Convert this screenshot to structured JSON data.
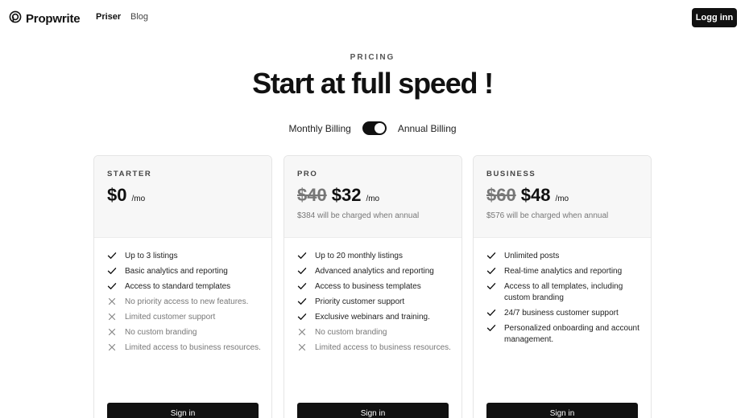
{
  "nav": {
    "brand": "Propwrite",
    "links": [
      "Priser",
      "Blog"
    ],
    "login": "Logg inn"
  },
  "hero": {
    "eyebrow": "PRICING",
    "title": "Start at full speed !"
  },
  "billing": {
    "monthly": "Monthly Billing",
    "annual": "Annual Billing",
    "annual_selected": true
  },
  "colors": {
    "accent": "#111111",
    "muted": "#777777",
    "card_header_bg": "#f7f7f7"
  },
  "plans": [
    {
      "name": "STARTER",
      "old_price": "",
      "price": "$0",
      "per": "/mo",
      "note": "",
      "cta": "Sign in",
      "features": [
        {
          "text": "Up to 3 listings",
          "included": true
        },
        {
          "text": "Basic analytics and reporting",
          "included": true
        },
        {
          "text": "Access to standard templates",
          "included": true
        },
        {
          "text": "No priority access to new features.",
          "included": false
        },
        {
          "text": "Limited customer support",
          "included": false
        },
        {
          "text": "No custom branding",
          "included": false
        },
        {
          "text": "Limited access to business resources.",
          "included": false
        }
      ]
    },
    {
      "name": "PRO",
      "old_price": "$40",
      "price": "$32",
      "per": "/mo",
      "note": "$384 will be charged when annual",
      "cta": "Sign in",
      "features": [
        {
          "text": "Up to 20 monthly listings",
          "included": true
        },
        {
          "text": "Advanced analytics and reporting",
          "included": true
        },
        {
          "text": "Access to business templates",
          "included": true
        },
        {
          "text": "Priority customer support",
          "included": true
        },
        {
          "text": "Exclusive webinars and training.",
          "included": true
        },
        {
          "text": "No custom branding",
          "included": false
        },
        {
          "text": "Limited access to business resources.",
          "included": false
        }
      ]
    },
    {
      "name": "BUSINESS",
      "old_price": "$60",
      "price": "$48",
      "per": "/mo",
      "note": "$576 will be charged when annual",
      "cta": "Sign in",
      "features": [
        {
          "text": "Unlimited posts",
          "included": true
        },
        {
          "text": "Real-time analytics and reporting",
          "included": true
        },
        {
          "text": "Access to all templates, including custom branding",
          "included": true
        },
        {
          "text": "24/7 business customer support",
          "included": true
        },
        {
          "text": "Personalized onboarding and account management.",
          "included": true
        }
      ]
    }
  ]
}
